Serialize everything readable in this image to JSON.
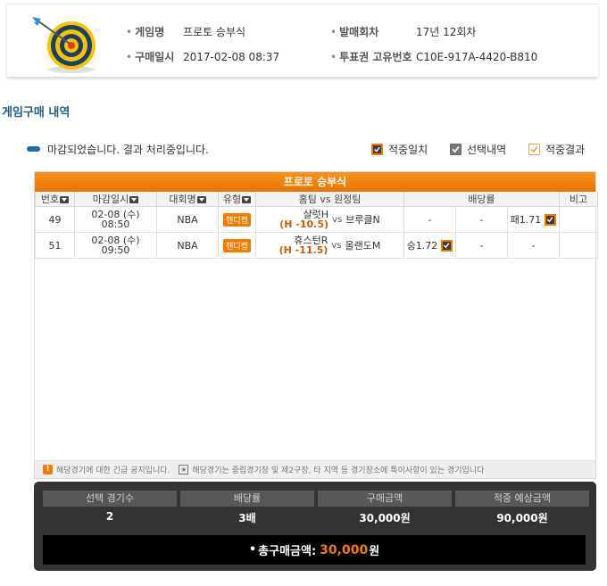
{
  "info": {
    "game_label": "게임명",
    "game_value": "프로토 승부식",
    "purchase_date_label": "구매일시",
    "purchase_date_value": "2017-02-08 08:37",
    "round_label": "발매회차",
    "round_value": "17년 12회차",
    "ticket_id_label": "투표권 고유번호",
    "ticket_id_value": "C10E-917A-4420-B810"
  },
  "section_title": "게임구매 내역",
  "status_text": "마감되었습니다. 결과 처리중입니다.",
  "legend": {
    "match": "적중일치",
    "selected": "선택내역",
    "result": "적중결과"
  },
  "panel_title": "프로토 승부식",
  "columns": [
    "번호",
    "마감일시",
    "대회명",
    "유형",
    "홈팀 vs 원정팀",
    "배당률",
    "비고"
  ],
  "rows": [
    {
      "no": "49",
      "date": "02-08 (수)",
      "time": "08:50",
      "league": "NBA",
      "type": "핸디캡",
      "home": "샬럿H",
      "handicap": "(H -10.5)",
      "vs": "vs",
      "away": "브루클N",
      "odd1": "-",
      "odd2": "-",
      "odd3": "패1.71",
      "selected_col": 3
    },
    {
      "no": "51",
      "date": "02-08 (수)",
      "time": "09:50",
      "league": "NBA",
      "type": "핸디캡",
      "home": "휴스턴R",
      "handicap": "(H -11.5)",
      "vs": "vs",
      "away": "올랜도M",
      "odd1": "승1.72",
      "odd2": "-",
      "odd3": "-",
      "selected_col": 1
    }
  ],
  "notice": {
    "warn_text": "해당경기에 대한 긴급 공지입니다.",
    "star_text": "해당경기는 중립경기장 및 제2구장, 타 지역 등 경기장소에 특이사항이 있는 경기입니다"
  },
  "summary": {
    "count_label": "선택 경기수",
    "count_value": "2",
    "odds_label": "배당률",
    "odds_value": "3배",
    "amount_label": "구매금액",
    "amount_value": "30,000원",
    "expected_label": "적중 예상금액",
    "expected_value": "90,000원",
    "total_label": "총구매금액:",
    "total_amount": "30,000",
    "total_unit": "원"
  },
  "colors": {
    "accent": "#f27b00",
    "title_blue": "#1d5f84",
    "summary_bg": "#333333"
  }
}
